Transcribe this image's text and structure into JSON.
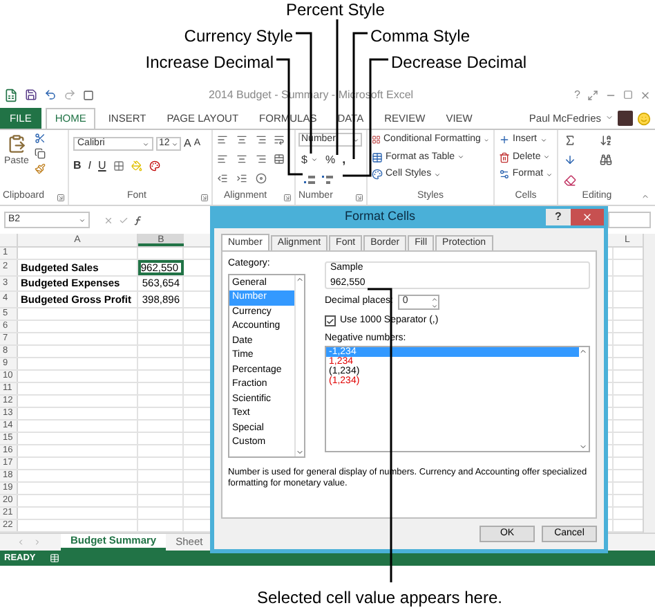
{
  "callouts": [
    {
      "label": "Percent Style"
    },
    {
      "label": "Currency Style"
    },
    {
      "label": "Comma Style"
    },
    {
      "label": "Increase Decimal"
    },
    {
      "label": "Decrease Decimal"
    },
    {
      "label": "Selected cell value appears here."
    }
  ],
  "window": {
    "title": "2014 Budget - Summary - Microsoft Excel",
    "help": "?",
    "user": "Paul McFedries"
  },
  "ribbon_tabs": [
    {
      "label": "FILE",
      "kind": "file",
      "selected": false
    },
    {
      "label": "HOME",
      "kind": "tab",
      "selected": true
    },
    {
      "label": "INSERT",
      "kind": "tab",
      "selected": false
    },
    {
      "label": "PAGE LAYOUT",
      "kind": "tab",
      "selected": false
    },
    {
      "label": "FORMULAS",
      "kind": "tab",
      "selected": false
    },
    {
      "label": "DATA",
      "kind": "tab",
      "selected": false
    },
    {
      "label": "REVIEW",
      "kind": "tab",
      "selected": false
    },
    {
      "label": "VIEW",
      "kind": "tab",
      "selected": false
    }
  ],
  "ribbon": {
    "paste": "Paste",
    "font": "Calibri",
    "size": "12",
    "grow": "A",
    "shrink": "A",
    "bold": "B",
    "italic": "I",
    "underline": "U",
    "number_format": "Number",
    "currency": "$",
    "percent": "%",
    "comma": ",",
    "styles": [
      "Conditional Formatting",
      "Format as Table",
      "Cell Styles"
    ],
    "cells": [
      "Insert",
      "Delete",
      "Format"
    ],
    "groups": [
      "Clipboard",
      "Font",
      "Alignment",
      "Number",
      "Styles",
      "Cells",
      "Editing"
    ]
  },
  "name_box": "B2",
  "sheet": {
    "columns": [
      "A",
      "B",
      "L"
    ],
    "rows": [
      {
        "number": "1"
      },
      {
        "number": "2",
        "label": "Budgeted Sales",
        "value": "962,550",
        "selected": true
      },
      {
        "number": "3",
        "label": "Budgeted Expenses",
        "value": "563,654",
        "selected": false
      },
      {
        "number": "4",
        "label": "Budgeted Gross Profit",
        "value": "398,896",
        "selected": false
      },
      {
        "number": "5"
      },
      {
        "number": "6"
      },
      {
        "number": "7"
      },
      {
        "number": "8"
      },
      {
        "number": "9"
      },
      {
        "number": "10"
      },
      {
        "number": "11"
      },
      {
        "number": "12"
      },
      {
        "number": "13"
      },
      {
        "number": "14"
      },
      {
        "number": "15"
      },
      {
        "number": "16"
      },
      {
        "number": "17"
      },
      {
        "number": "18"
      },
      {
        "number": "19"
      },
      {
        "number": "20"
      },
      {
        "number": "21"
      },
      {
        "number": "22"
      }
    ]
  },
  "sheet_tabs": [
    {
      "label": "Budget Summary",
      "selected": true
    },
    {
      "label": "Sheet",
      "selected": false
    }
  ],
  "status": "READY",
  "dialog": {
    "title": "Format Cells",
    "help": "?",
    "tabs": [
      {
        "label": "Number",
        "selected": true
      },
      {
        "label": "Alignment",
        "selected": false
      },
      {
        "label": "Font",
        "selected": false
      },
      {
        "label": "Border",
        "selected": false
      },
      {
        "label": "Fill",
        "selected": false
      },
      {
        "label": "Protection",
        "selected": false
      }
    ],
    "category_label": "Category:",
    "categories": [
      {
        "label": "General",
        "selected": false
      },
      {
        "label": "Number",
        "selected": true
      },
      {
        "label": "Currency",
        "selected": false
      },
      {
        "label": "Accounting",
        "selected": false
      },
      {
        "label": "Date",
        "selected": false
      },
      {
        "label": "Time",
        "selected": false
      },
      {
        "label": "Percentage",
        "selected": false
      },
      {
        "label": "Fraction",
        "selected": false
      },
      {
        "label": "Scientific",
        "selected": false
      },
      {
        "label": "Text",
        "selected": false
      },
      {
        "label": "Special",
        "selected": false
      },
      {
        "label": "Custom",
        "selected": false
      }
    ],
    "sample_label": "Sample",
    "sample": "962,550",
    "decimal_label": "Decimal places:",
    "decimal_value": "0",
    "separator": {
      "label": "Use 1000 Separator (,)",
      "checked": true
    },
    "negative_label": "Negative numbers:",
    "negatives": [
      {
        "text": "-1,234",
        "kind": "black",
        "selected": true
      },
      {
        "text": "1,234",
        "kind": "red",
        "selected": false
      },
      {
        "text": "(1,234)",
        "kind": "black",
        "selected": false
      },
      {
        "text": "(1,234)",
        "kind": "red",
        "selected": false
      }
    ],
    "description": "Number is used for general display of numbers.  Currency and Accounting offer specialized formatting for monetary value.",
    "buttons": [
      "OK",
      "Cancel"
    ]
  }
}
